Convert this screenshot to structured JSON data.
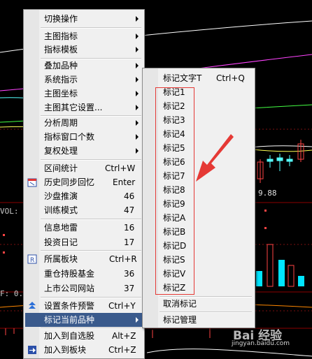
{
  "background": {
    "price_label": "9.88",
    "vol_label": "VOL: 9",
    "indicator_label": "F: 0.1"
  },
  "main_menu": {
    "items": [
      {
        "label": "切换操作",
        "submenu": true
      },
      {
        "label": "主图指标",
        "submenu": true
      },
      {
        "label": "指标模板",
        "submenu": true
      },
      {
        "label": "叠加品种",
        "submenu": true
      },
      {
        "label": "系统指示",
        "submenu": true
      },
      {
        "label": "主图坐标",
        "submenu": true
      },
      {
        "label": "主图其它设置...",
        "submenu": true
      },
      {
        "label": "分析周期",
        "submenu": true
      },
      {
        "label": "指标窗口个数",
        "submenu": true
      },
      {
        "label": "复权处理",
        "submenu": true
      },
      {
        "label": "区间统计",
        "shortcut": "Ctrl+W"
      },
      {
        "label": "历史同步回忆",
        "shortcut": "Enter",
        "icon": "calendar-icon"
      },
      {
        "label": "沙盘推演",
        "shortcut": "46"
      },
      {
        "label": "训练模式",
        "shortcut": "47"
      },
      {
        "label": "信息地雷",
        "shortcut": "16"
      },
      {
        "label": "投资日记",
        "shortcut": "17"
      },
      {
        "label": "所属板块",
        "shortcut": "Ctrl+R",
        "icon": "r-box-icon"
      },
      {
        "label": "重仓持股基金",
        "shortcut": "36"
      },
      {
        "label": "上市公司网站",
        "shortcut": "37"
      },
      {
        "label": "设置条件预警",
        "shortcut": "Ctrl+Y",
        "icon": "alert-arrows-icon"
      },
      {
        "label": "标记当前品种",
        "submenu": true,
        "selected": true
      },
      {
        "label": "加入到自选股",
        "shortcut": "Alt+Z"
      },
      {
        "label": "加入到板块",
        "shortcut": "Ctrl+Z",
        "icon": "add-to-block-icon"
      }
    ]
  },
  "sub_menu": {
    "items": [
      {
        "label": "标记文字T",
        "shortcut": "Ctrl+Q"
      },
      {
        "label": "标记1"
      },
      {
        "label": "标记2"
      },
      {
        "label": "标记3"
      },
      {
        "label": "标记4"
      },
      {
        "label": "标记5"
      },
      {
        "label": "标记6"
      },
      {
        "label": "标记7"
      },
      {
        "label": "标记8"
      },
      {
        "label": "标记9"
      },
      {
        "label": "标记A"
      },
      {
        "label": "标记B"
      },
      {
        "label": "标记D"
      },
      {
        "label": "标记S"
      },
      {
        "label": "标记V"
      },
      {
        "label": "标记Z"
      },
      {
        "label": "取消标记"
      },
      {
        "label": "标记管理"
      }
    ]
  },
  "watermark": {
    "brand": "Bai 经验",
    "url": "jingyan.baidu.com"
  },
  "colors": {
    "selection": "#3a5a8c",
    "annotation": "#e53935",
    "menu_bg": "#f0f0f0"
  }
}
